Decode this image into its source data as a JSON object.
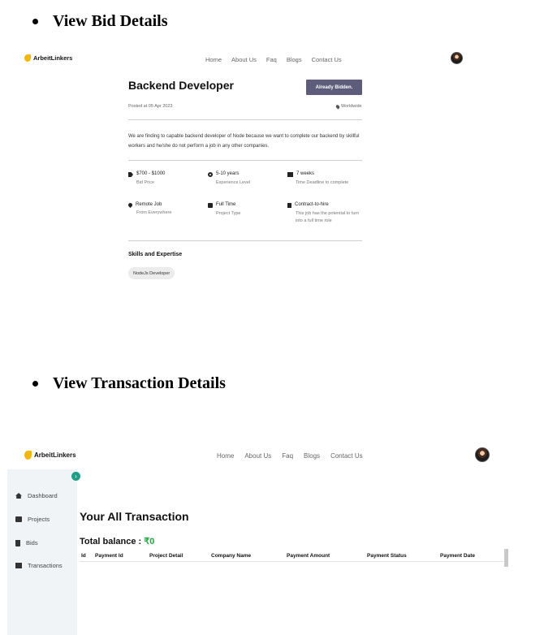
{
  "sections": {
    "bid_heading": "View Bid Details",
    "transaction_heading": "View Transaction Details"
  },
  "brand": {
    "name": "ArbeitLinkers"
  },
  "nav": [
    "Home",
    "About Us",
    "Faq",
    "Blogs",
    "Contact Us"
  ],
  "bid": {
    "job_title": "Backend Developer",
    "status_button": "Already Bidden.",
    "posted": "Posted at 05 Apr 2023",
    "location": "Worldwide",
    "description": "We are finding to capable backend developer of Node because we want to complete our backend by skillful workers and he/she do not perform a job in any other companies.",
    "details": [
      {
        "value": "$700 - $1000",
        "label": "Bid Price",
        "icon": "tag-icon"
      },
      {
        "value": "5-10 years",
        "label": "Experience Level",
        "icon": "gears-icon"
      },
      {
        "value": "7 weeks",
        "label": "Time Deadline to complete",
        "icon": "truck-icon"
      },
      {
        "value": "Remote Job",
        "label": "From Everywhere",
        "icon": "location-pin-icon"
      },
      {
        "value": "Full Time",
        "label": "Project Type",
        "icon": "briefcase-icon"
      },
      {
        "value": "Contract-to-hire",
        "label": "This job has the potential to turn into a full time role",
        "icon": "file-icon"
      }
    ],
    "skills_title": "Skills and Expertise",
    "skills": [
      "NodeJs Developer"
    ]
  },
  "sidebar": {
    "items": [
      {
        "label": "Dashboard",
        "icon": "home-icon"
      },
      {
        "label": "Projects",
        "icon": "briefcase-icon"
      },
      {
        "label": "Bids",
        "icon": "trash-icon"
      },
      {
        "label": "Transactions",
        "icon": "wallet-icon"
      }
    ],
    "toggle_icon": "chevron-right-icon"
  },
  "transactions": {
    "title": "Your All Transaction",
    "balance_label": "Total balance : ",
    "balance_value": "₹0",
    "columns": [
      "Id",
      "Payment Id",
      "Project Detail",
      "Company Name",
      "Payment Amount",
      "Payment Status",
      "Payment Date"
    ]
  },
  "colors": {
    "brand_yellow": "#f2b705",
    "button": "#5d5c7a",
    "balance_green": "#22a745",
    "sidebar_bg": "#f0f4f6",
    "toggle": "#1f9d85"
  }
}
